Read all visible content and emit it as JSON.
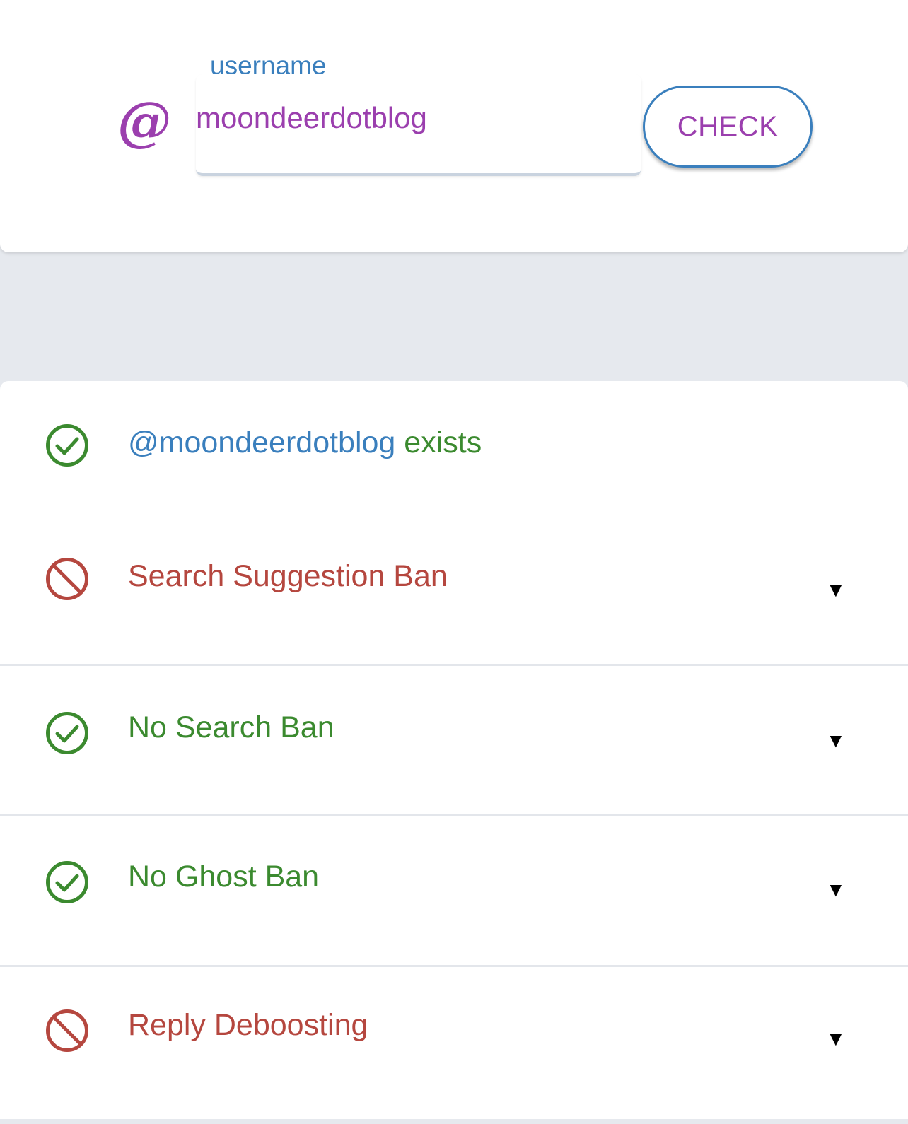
{
  "search": {
    "at_symbol": "@",
    "label": "username",
    "value": "moondeerdotblog",
    "button_label": "CHECK"
  },
  "results": [
    {
      "status": "ok",
      "mention": "@moondeerdotblog",
      "text": " exists",
      "expandable": false,
      "icon": "check-circle-icon"
    },
    {
      "status": "bad",
      "text": "Search Suggestion Ban",
      "expandable": true,
      "icon": "ban-icon"
    },
    {
      "status": "ok",
      "text": "No Search Ban",
      "expandable": true,
      "icon": "check-circle-icon"
    },
    {
      "status": "ok",
      "text": "No Ghost Ban",
      "expandable": true,
      "icon": "check-circle-icon"
    },
    {
      "status": "bad",
      "text": "Reply Deboosting",
      "expandable": true,
      "icon": "ban-icon"
    }
  ],
  "caret_glyph": "▼",
  "colors": {
    "accent_purple": "#9b3fae",
    "accent_blue": "#3a7fbd",
    "ok_green": "#3b8a2f",
    "bad_red": "#b5473f",
    "page_background": "#e6e9ee"
  }
}
